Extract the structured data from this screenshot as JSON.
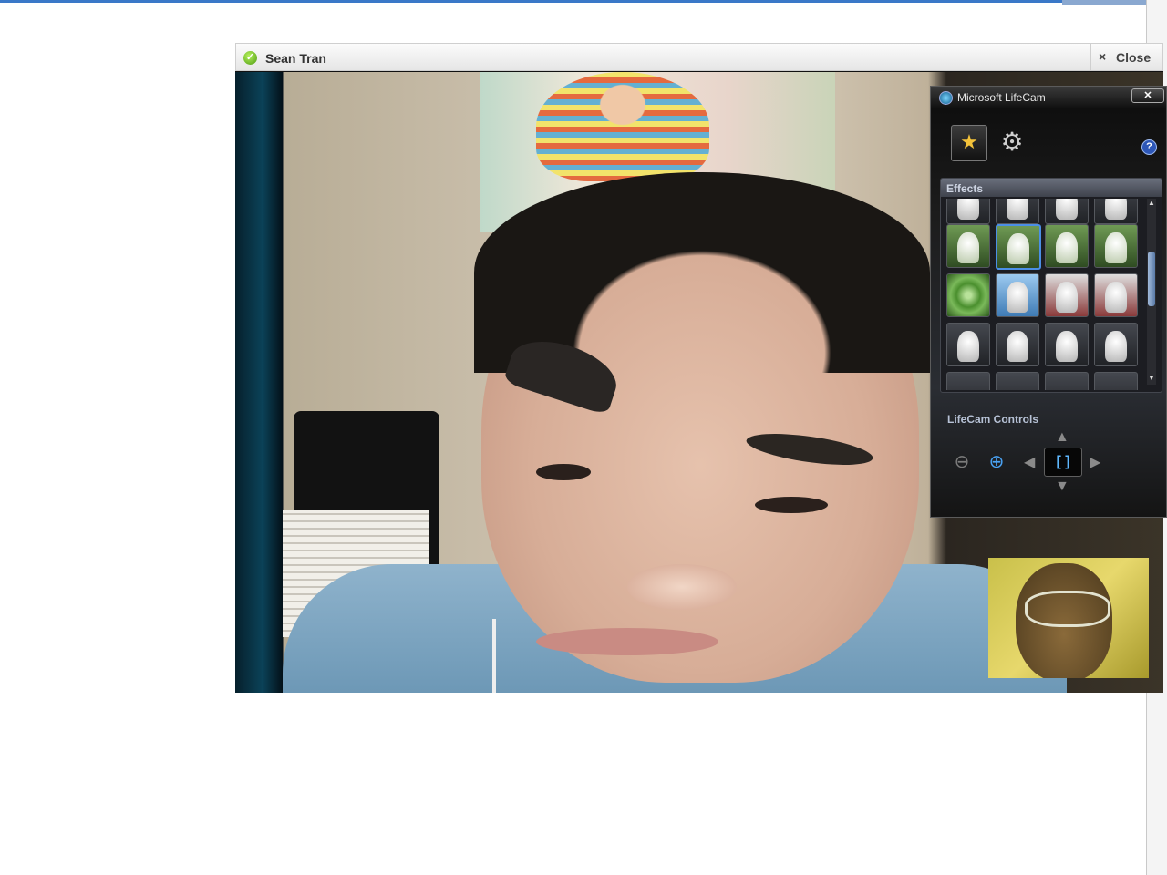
{
  "call": {
    "contact_name": "Sean Tran",
    "close_label": "Close",
    "close_icon": "×",
    "status_icon": "✓"
  },
  "lifecam": {
    "title": "Microsoft LifeCam",
    "close_icon": "✕",
    "effects_tab_icon": "★",
    "settings_icon": "⚙",
    "help_icon": "?",
    "effects_label": "Effects",
    "controls_label": "LifeCam Controls",
    "zoom_out_icon": "⊖",
    "zoom_in_icon": "⊕",
    "pan_left_icon": "◀",
    "pan_right_icon": "▶",
    "tilt_up_icon": "▲",
    "tilt_down_icon": "▼",
    "center_icon": "[ ]",
    "scroll_up_icon": "▲",
    "scroll_down_icon": "▼",
    "effect_rows": [
      [
        "avatar",
        "avatar",
        "avatar",
        "avatar"
      ],
      [
        "bowling-pins",
        "alien-selected",
        "bowling-pins",
        "alien"
      ],
      [
        "green-swirl",
        "snowman-face",
        "pirate-mask",
        "cat-face"
      ],
      [
        "clown-face",
        "cowboy-hat",
        "panda-face",
        "cursing-face"
      ],
      [
        "avatar",
        "lamp",
        "hair",
        "avatar"
      ]
    ]
  }
}
